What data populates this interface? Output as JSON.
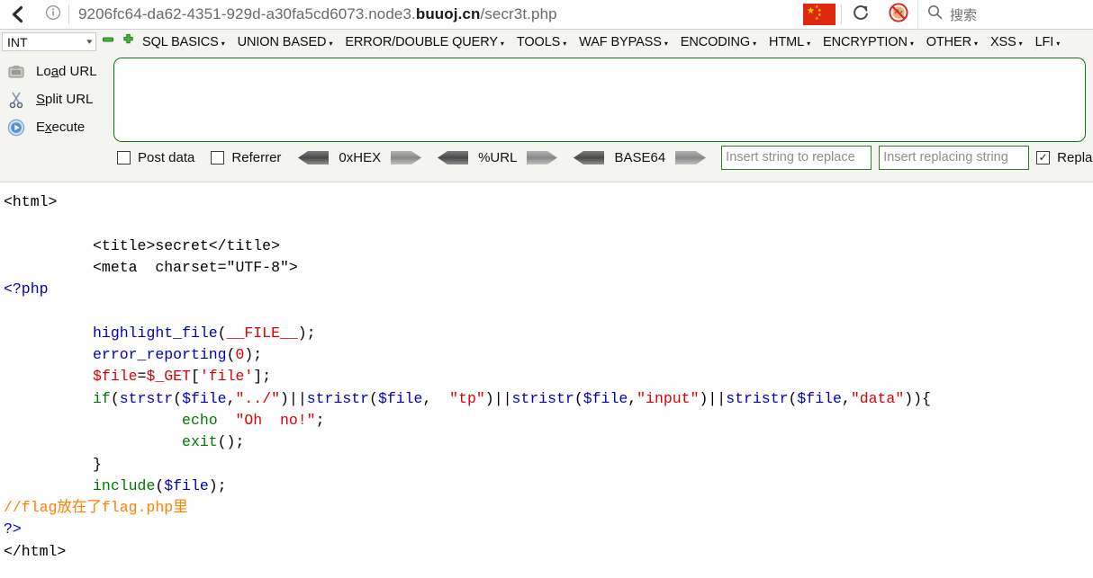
{
  "browser": {
    "back_icon": "back-arrow-icon",
    "info_icon": "info-circle-icon",
    "url_prefix": "9206fc64-da62-4351-929d-a30fa5cd6073.node3.",
    "url_host": "buuoj.cn",
    "url_path": "/secr3t.php",
    "flag_icon": "china-flag-icon",
    "reload_icon": "reload-icon",
    "block_icon": "block-ads-icon",
    "search_icon": "search-icon",
    "search_placeholder": "搜索"
  },
  "hackbar": {
    "type_select": {
      "value": "INT",
      "chevron": "▾"
    },
    "remove_icon": "minus-icon",
    "add_icon": "plus-icon",
    "menu": [
      {
        "label": "SQL BASICS",
        "caret": "▾"
      },
      {
        "label": "UNION BASED",
        "caret": "▾"
      },
      {
        "label": "ERROR/DOUBLE QUERY",
        "caret": "▾"
      },
      {
        "label": "TOOLS",
        "caret": "▾"
      },
      {
        "label": "WAF BYPASS",
        "caret": "▾"
      },
      {
        "label": "ENCODING",
        "caret": "▾"
      },
      {
        "label": "HTML",
        "caret": "▾"
      },
      {
        "label": "ENCRYPTION",
        "caret": "▾"
      },
      {
        "label": "OTHER",
        "caret": "▾"
      },
      {
        "label": "XSS",
        "caret": "▾"
      },
      {
        "label": "LFI",
        "caret": "▾"
      }
    ],
    "actions": [
      {
        "label_pre": "Lo",
        "accel": "a",
        "label_post": "d URL",
        "icon": "load-url-icon"
      },
      {
        "label_pre": "",
        "accel": "S",
        "label_post": "plit URL",
        "icon": "scissors-icon"
      },
      {
        "label_pre": "E",
        "accel": "x",
        "label_post": "ecute",
        "icon": "execute-play-icon"
      }
    ],
    "url_textarea": {
      "value": "",
      "placeholder": ""
    },
    "options": {
      "post_data": {
        "label": "Post data",
        "checked": false,
        "mark": ""
      },
      "referrer": {
        "label": "Referrer",
        "checked": false,
        "mark": ""
      },
      "codecs": [
        {
          "label": "0xHEX"
        },
        {
          "label": "%URL"
        },
        {
          "label": "BASE64"
        }
      ],
      "search_string": {
        "value": "",
        "placeholder": "Insert string to replace"
      },
      "replace_string": {
        "value": "",
        "placeholder": "Insert replacing string"
      },
      "replace_toggle": {
        "label": "Repla",
        "checked": true,
        "mark": "✓"
      }
    }
  },
  "source": {
    "lines": [
      {
        "indent": 0,
        "parts": [
          {
            "t": "<html>",
            "c": "c-html"
          }
        ]
      },
      {
        "indent": 0,
        "parts": []
      },
      {
        "indent": 5,
        "parts": [
          {
            "t": "<title>secret</title>",
            "c": "c-html"
          }
        ]
      },
      {
        "indent": 5,
        "parts": [
          {
            "t": "<meta  charset=\"UTF-8\">",
            "c": "c-html"
          }
        ]
      },
      {
        "indent": 0,
        "parts": [
          {
            "t": "<?php",
            "c": "c-php"
          }
        ]
      },
      {
        "indent": 0,
        "parts": []
      },
      {
        "indent": 5,
        "parts": [
          {
            "t": "highlight_file",
            "c": "c-fn"
          },
          {
            "t": "(",
            "c": "c-html"
          },
          {
            "t": "__FILE__",
            "c": "c-str"
          },
          {
            "t": ");",
            "c": "c-html"
          }
        ]
      },
      {
        "indent": 5,
        "parts": [
          {
            "t": "error_reporting",
            "c": "c-fn"
          },
          {
            "t": "(",
            "c": "c-html"
          },
          {
            "t": "0",
            "c": "c-str"
          },
          {
            "t": ");",
            "c": "c-html"
          }
        ]
      },
      {
        "indent": 5,
        "parts": [
          {
            "t": "$file",
            "c": "c-str"
          },
          {
            "t": "=",
            "c": "c-html"
          },
          {
            "t": "$_GET",
            "c": "c-str"
          },
          {
            "t": "[",
            "c": "c-html"
          },
          {
            "t": "'file'",
            "c": "c-str"
          },
          {
            "t": "];",
            "c": "c-html"
          }
        ]
      },
      {
        "indent": 5,
        "parts": [
          {
            "t": "if",
            "c": "c-kw"
          },
          {
            "t": "(",
            "c": "c-html"
          },
          {
            "t": "strstr",
            "c": "c-fn"
          },
          {
            "t": "(",
            "c": "c-html"
          },
          {
            "t": "$file",
            "c": "c-var"
          },
          {
            "t": ",",
            "c": "c-html"
          },
          {
            "t": "\"../\"",
            "c": "c-str"
          },
          {
            "t": ")||",
            "c": "c-html"
          },
          {
            "t": "stristr",
            "c": "c-fn"
          },
          {
            "t": "(",
            "c": "c-html"
          },
          {
            "t": "$file",
            "c": "c-var"
          },
          {
            "t": ", ",
            "c": "c-html"
          },
          {
            "t": " \"tp\"",
            "c": "c-str"
          },
          {
            "t": ")||",
            "c": "c-html"
          },
          {
            "t": "stristr",
            "c": "c-fn"
          },
          {
            "t": "(",
            "c": "c-html"
          },
          {
            "t": "$file",
            "c": "c-var"
          },
          {
            "t": ",",
            "c": "c-html"
          },
          {
            "t": "\"input\"",
            "c": "c-str"
          },
          {
            "t": ")||",
            "c": "c-html"
          },
          {
            "t": "stristr",
            "c": "c-fn"
          },
          {
            "t": "(",
            "c": "c-html"
          },
          {
            "t": "$file",
            "c": "c-var"
          },
          {
            "t": ",",
            "c": "c-html"
          },
          {
            "t": "\"data\"",
            "c": "c-str"
          },
          {
            "t": ")){",
            "c": "c-html"
          }
        ]
      },
      {
        "indent": 10,
        "parts": [
          {
            "t": "echo",
            "c": "c-kw"
          },
          {
            "t": "  ",
            "c": "c-html"
          },
          {
            "t": "\"Oh  no!\"",
            "c": "c-str"
          },
          {
            "t": ";",
            "c": "c-html"
          }
        ]
      },
      {
        "indent": 10,
        "parts": [
          {
            "t": "exit",
            "c": "c-kw"
          },
          {
            "t": "();",
            "c": "c-html"
          }
        ]
      },
      {
        "indent": 5,
        "parts": [
          {
            "t": "}",
            "c": "c-html"
          }
        ]
      },
      {
        "indent": 5,
        "parts": [
          {
            "t": "include",
            "c": "c-kw"
          },
          {
            "t": "(",
            "c": "c-html"
          },
          {
            "t": "$file",
            "c": "c-var"
          },
          {
            "t": ");",
            "c": "c-html"
          }
        ]
      },
      {
        "indent": 0,
        "parts": [
          {
            "t": "//flag放在了flag.php里",
            "c": "c-cmt"
          }
        ]
      },
      {
        "indent": 0,
        "parts": [
          {
            "t": "?>",
            "c": "c-php"
          }
        ]
      },
      {
        "indent": 0,
        "parts": [
          {
            "t": "</html>",
            "c": "c-html"
          }
        ]
      }
    ]
  }
}
